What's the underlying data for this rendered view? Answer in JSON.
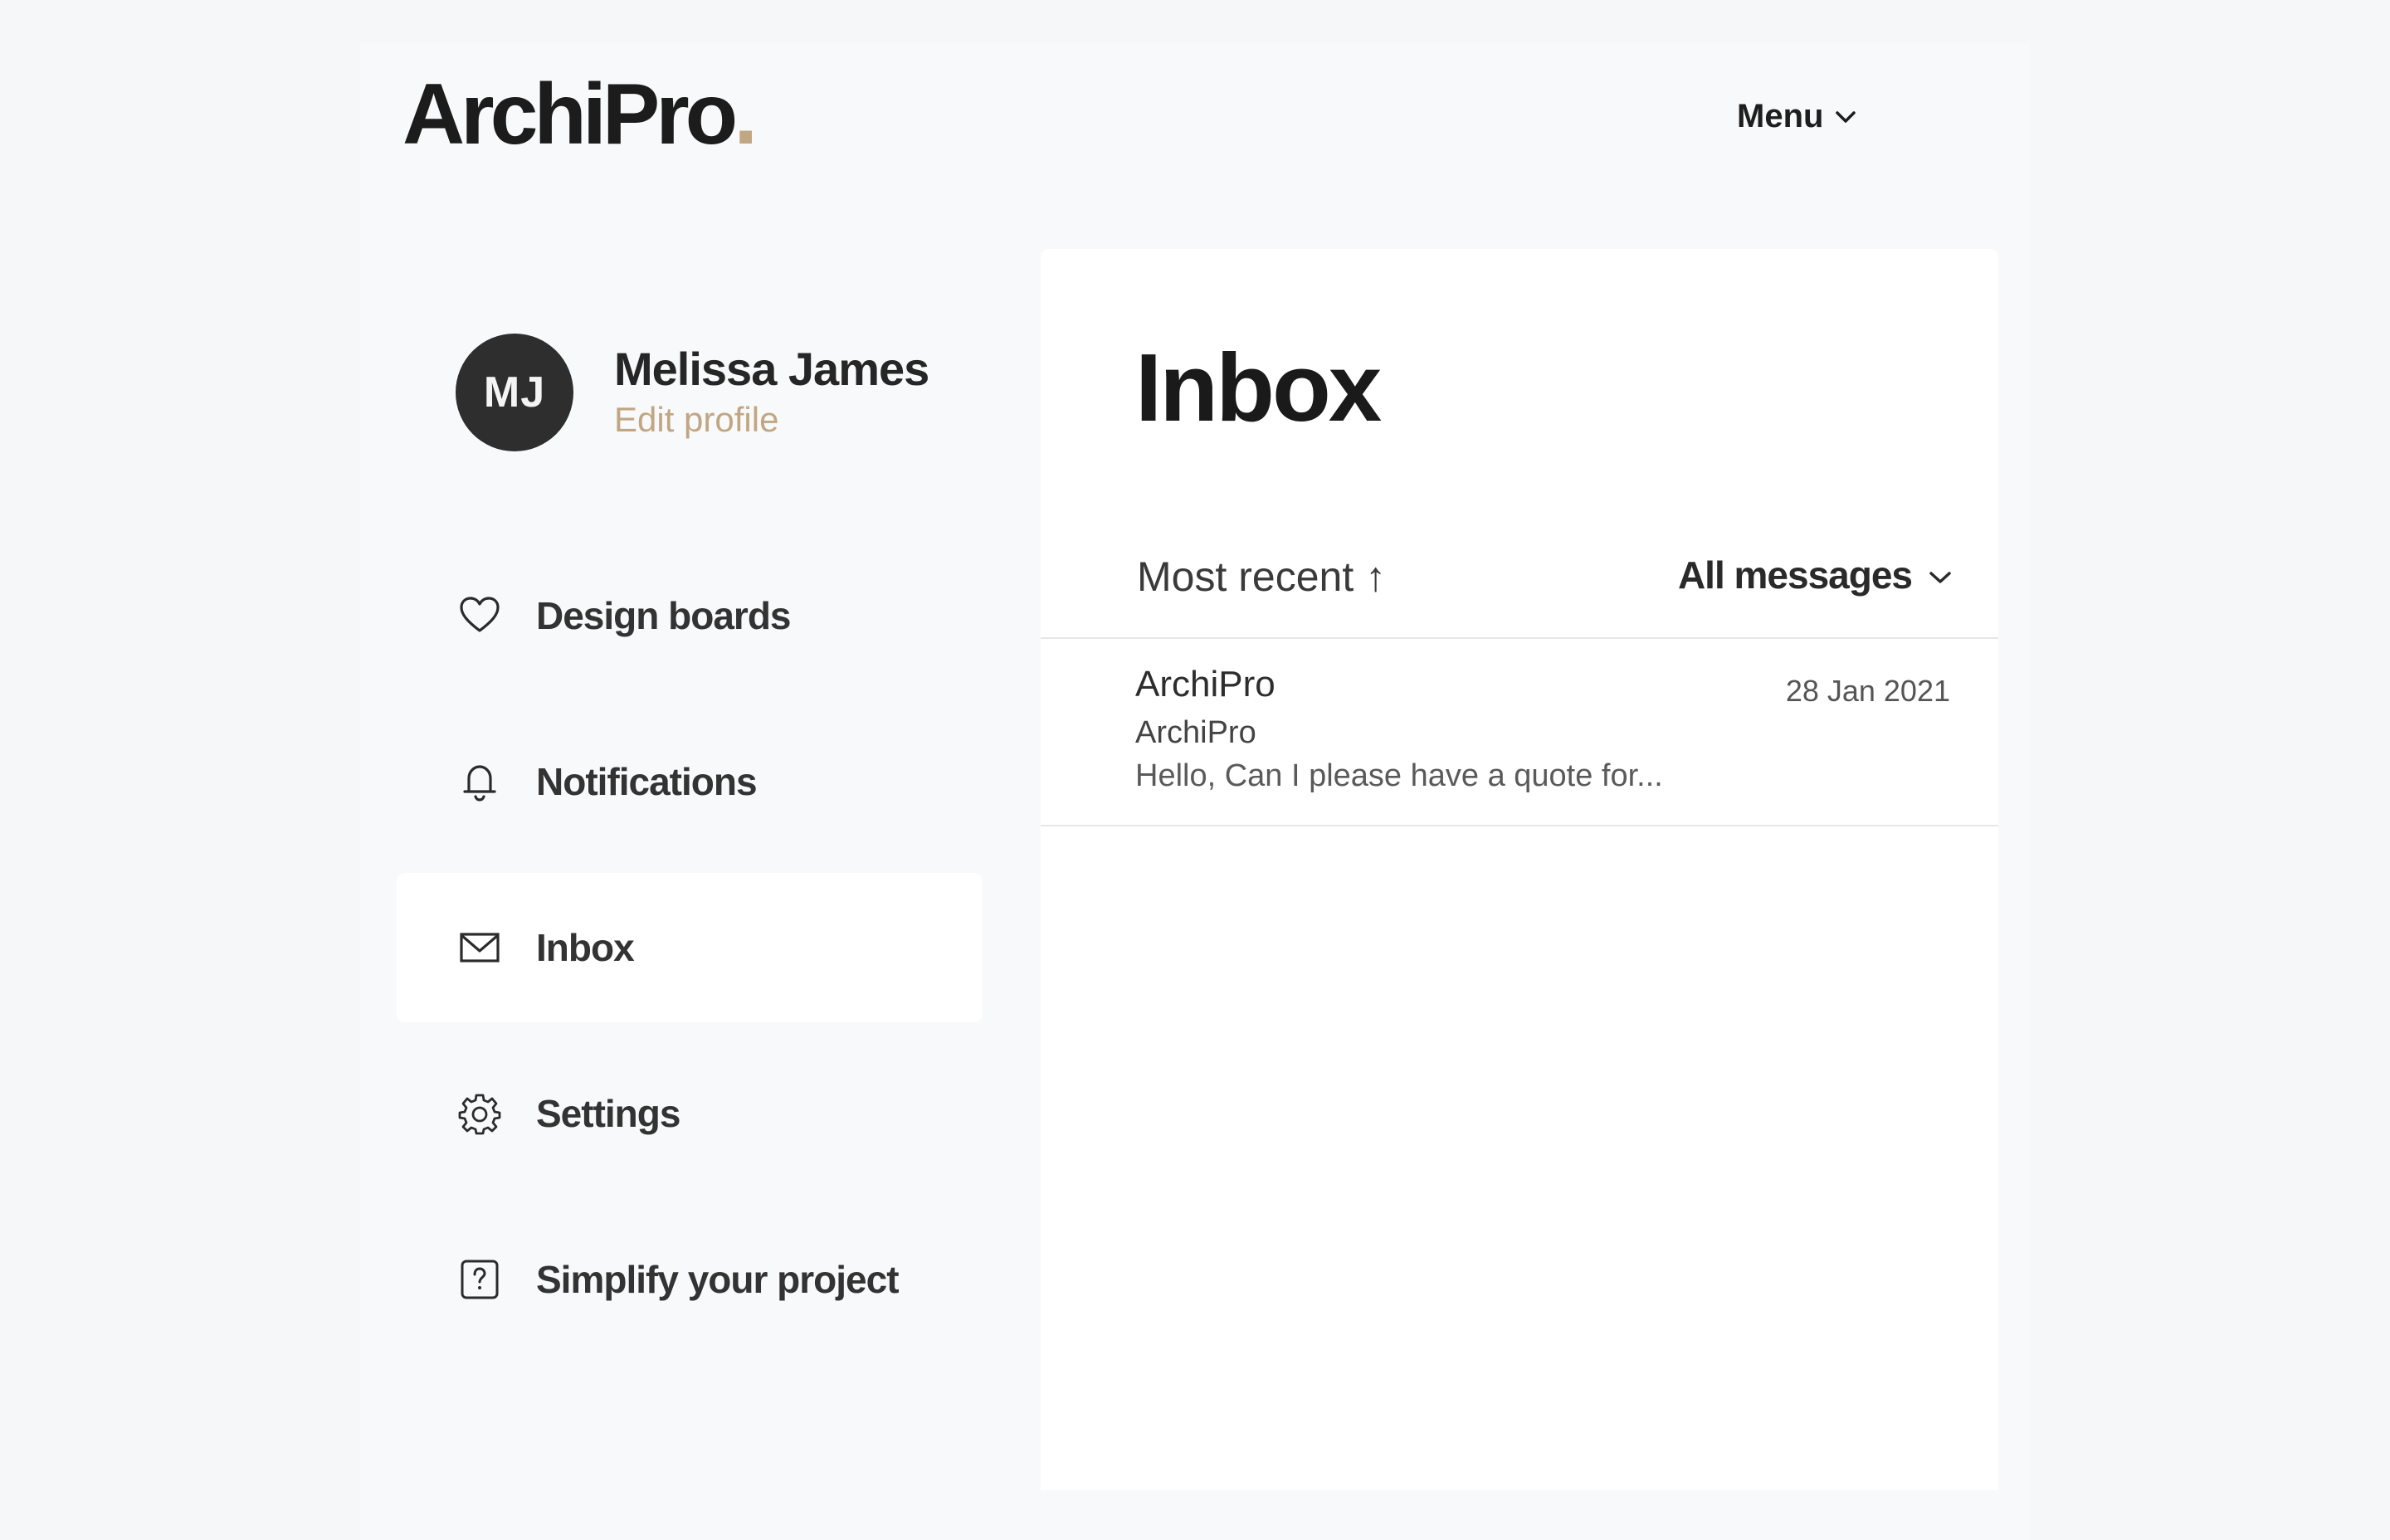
{
  "header": {
    "logo_text": "ArchiPro",
    "logo_dot": ".",
    "menu_label": "Menu"
  },
  "profile": {
    "initials": "MJ",
    "name": "Melissa James",
    "edit_label": "Edit profile"
  },
  "sidebar": {
    "items": [
      {
        "label": "Design boards",
        "icon": "heart-icon",
        "active": false
      },
      {
        "label": "Notifications",
        "icon": "bell-icon",
        "active": false
      },
      {
        "label": "Inbox",
        "icon": "mail-icon",
        "active": true
      },
      {
        "label": "Settings",
        "icon": "gear-icon",
        "active": false
      },
      {
        "label": "Simplify your project",
        "icon": "help-icon",
        "active": false
      }
    ]
  },
  "inbox": {
    "title": "Inbox",
    "sort_label": "Most recent ↑",
    "filter_label": "All messages",
    "messages": [
      {
        "from": "ArchiPro",
        "date": "28 Jan 2021",
        "subject": "ArchiPro",
        "preview": "Hello, Can I please have a quote for..."
      }
    ]
  },
  "colors": {
    "accent": "#c1a683",
    "background": "#f8f9fa",
    "panel": "#ffffff",
    "avatar": "#2e2e2e"
  }
}
